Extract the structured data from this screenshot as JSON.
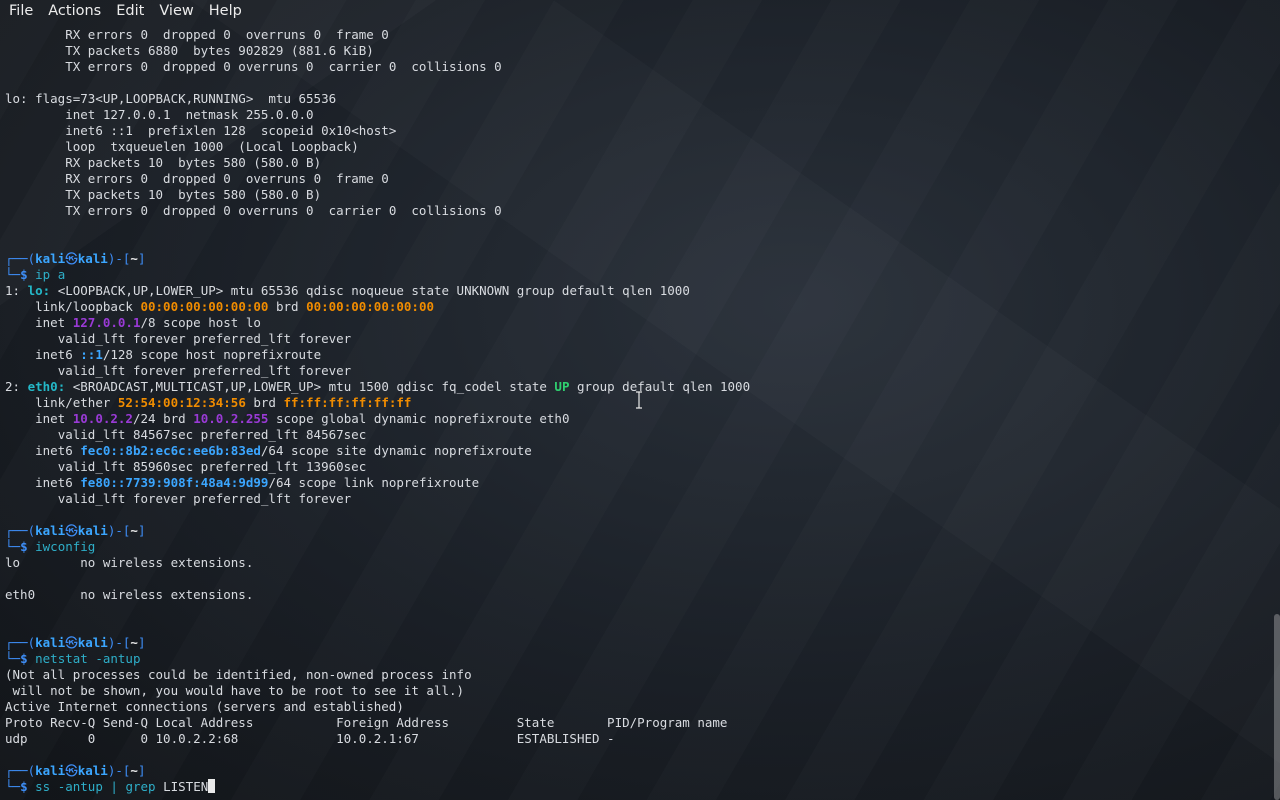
{
  "menubar": {
    "items": [
      "File",
      "Actions",
      "Edit",
      "View",
      "Help"
    ]
  },
  "prompt": {
    "user": "kali",
    "host": "kali",
    "dir": "~",
    "symbol": "$"
  },
  "terminal": {
    "ifconfig_tail": {
      "eth0_rx_errors": "RX errors 0  dropped 0  overruns 0  frame 0",
      "eth0_tx_packets": "TX packets 6880  bytes 902829 (881.6 KiB)",
      "eth0_tx_errors": "TX errors 0  dropped 0 overruns 0  carrier 0  collisions 0",
      "lo_flags": "lo: flags=73<UP,LOOPBACK,RUNNING>  mtu 65536",
      "lo_inet": "inet 127.0.0.1  netmask 255.0.0.0",
      "lo_inet6": "inet6 ::1  prefixlen 128  scopeid 0x10<host>",
      "lo_loop": "loop  txqueuelen 1000  (Local Loopback)",
      "lo_rx_packets": "RX packets 10  bytes 580 (580.0 B)",
      "lo_rx_errors": "RX errors 0  dropped 0  overruns 0  frame 0",
      "lo_tx_packets": "TX packets 10  bytes 580 (580.0 B)",
      "lo_tx_errors": "TX errors 0  dropped 0 overruns 0  carrier 0  collisions 0"
    },
    "cmd_ip": "ip a",
    "ip": {
      "lo_num": "1:",
      "lo_name": "lo:",
      "lo_rest": "<LOOPBACK,UP,LOWER_UP> mtu 65536 qdisc noqueue state UNKNOWN group default qlen 1000",
      "lo_link_label": "link/loopback",
      "lo_mac": "00:00:00:00:00:00",
      "brd": "brd",
      "lo_brd": "00:00:00:00:00:00",
      "lo_inet_label": "inet",
      "lo_inet_addr": "127.0.0.1",
      "lo_inet_rest": "/8 scope host lo",
      "valid1": "valid_lft forever preferred_lft forever",
      "lo_inet6_label": "inet6",
      "lo_inet6_addr": "::1",
      "lo_inet6_rest": "/128 scope host noprefixroute",
      "valid2": "valid_lft forever preferred_lft forever",
      "eth_num": "2:",
      "eth_name": "eth0:",
      "eth_rest_a": "<BROADCAST,MULTICAST,UP,LOWER_UP> mtu 1500 qdisc fq_codel state",
      "eth_state": "UP",
      "eth_rest_b": "group default qlen 1000",
      "eth_link_label": "link/ether",
      "eth_mac": "52:54:00:12:34:56",
      "eth_brd": "ff:ff:ff:ff:ff:ff",
      "eth_inet_label": "inet",
      "eth_inet_addr": "10.0.2.2",
      "eth_inet_mid": "/24 brd",
      "eth_inet_brd": "10.0.2.255",
      "eth_inet_rest": "scope global dynamic noprefixroute eth0",
      "valid3": "valid_lft 84567sec preferred_lft 84567sec",
      "eth_inet6a_label": "inet6",
      "eth_inet6a_addr": "fec0::8b2:ec6c:ee6b:83ed",
      "eth_inet6a_rest": "/64 scope site dynamic noprefixroute",
      "valid4": "valid_lft 85960sec preferred_lft 13960sec",
      "eth_inet6b_label": "inet6",
      "eth_inet6b_addr": "fe80::7739:908f:48a4:9d99",
      "eth_inet6b_rest": "/64 scope link noprefixroute",
      "valid5": "valid_lft forever preferred_lft forever"
    },
    "cmd_iwconfig": "iwconfig",
    "iwconfig": {
      "lo_line": "lo        no wireless extensions.",
      "eth_line": "eth0      no wireless extensions."
    },
    "cmd_netstat": "netstat -antup",
    "netstat": {
      "note1": "(Not all processes could be identified, non-owned process info",
      "note2": " will not be shown, you would have to be root to see it all.)",
      "heading": "Active Internet connections (servers and established)",
      "columns": "Proto Recv-Q Send-Q Local Address           Foreign Address         State       PID/Program name",
      "row1": "udp        0      0 10.0.2.2:68             10.0.2.1:67             ESTABLISHED -"
    },
    "cmd_ss_a": "ss -antup |",
    "cmd_ss_grep": "grep",
    "cmd_ss_b": "LISTEN"
  }
}
